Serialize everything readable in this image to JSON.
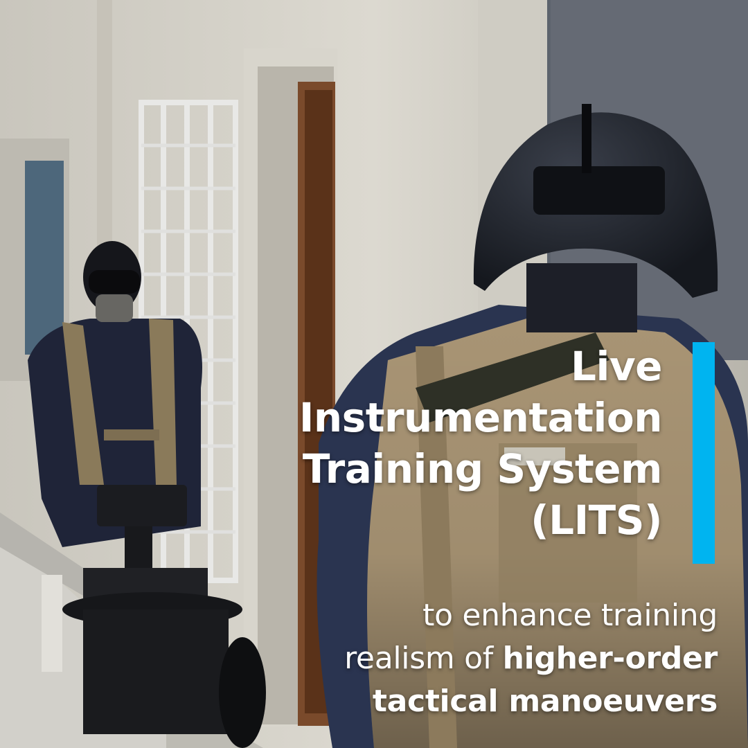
{
  "title": {
    "lines": [
      "Live",
      "Instrumentation",
      "Training System",
      "(LITS)"
    ]
  },
  "subtitle": {
    "line1": "to enhance training",
    "line2_regular": "realism of ",
    "line2_bold": "higher-order",
    "line3": "tactical manoeuvers"
  },
  "colors": {
    "accent": "#00B4F0",
    "text": "#FFFFFF"
  }
}
